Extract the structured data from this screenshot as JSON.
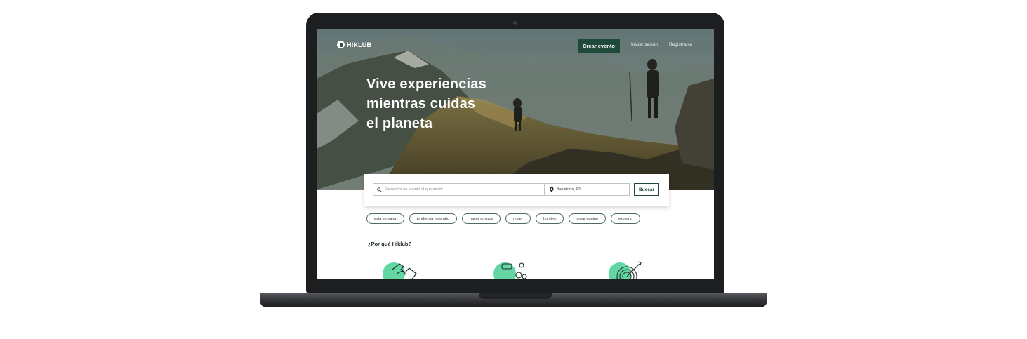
{
  "brand": {
    "name": "HIKLUB"
  },
  "nav": {
    "create_event": "Crear evento",
    "login": "Iniciar sesión",
    "register": "Registrarse"
  },
  "hero": {
    "line1": "Vive experiencias",
    "line2": "mientras cuidas",
    "line3": "el planeta"
  },
  "search": {
    "placeholder": "Encuentra un evento al que asistir",
    "location_value": "Barcelona, ES",
    "button": "Buscar"
  },
  "chips": [
    "esta semana",
    "tendencia este año",
    "hacer amigos",
    "mujer",
    "hombre",
    "crear equipo",
    "extremo"
  ],
  "section": {
    "why_title": "¿Por qué Hiklub?"
  },
  "colors": {
    "brand_green": "#1f4a3a",
    "accent_mint": "#63d6a3"
  },
  "icons": [
    "search-icon",
    "location-pin-icon",
    "puzzle-icon",
    "people-icon",
    "target-icon"
  ]
}
